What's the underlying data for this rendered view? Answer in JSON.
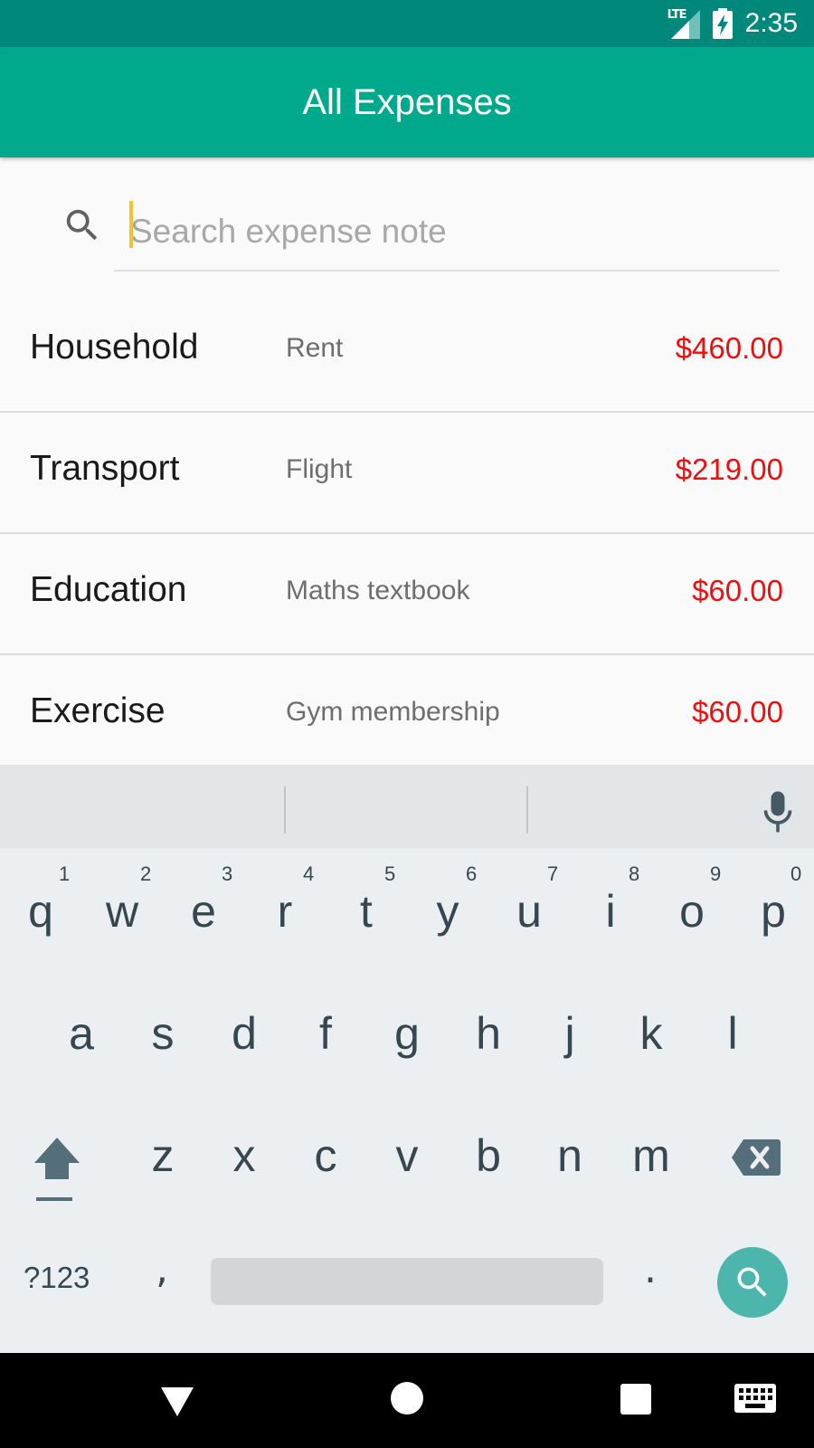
{
  "status_bar": {
    "network": "LTE",
    "time": "2:35"
  },
  "app_bar": {
    "title": "All Expenses"
  },
  "search": {
    "placeholder": "Search expense note",
    "value": ""
  },
  "expenses": [
    {
      "category": "Household",
      "note": "Rent",
      "amount": "$460.00"
    },
    {
      "category": "Transport",
      "note": "Flight",
      "amount": "$219.00"
    },
    {
      "category": "Education",
      "note": "Maths textbook",
      "amount": "$60.00"
    },
    {
      "category": "Exercise",
      "note": "Gym membership",
      "amount": "$60.00"
    }
  ],
  "keyboard": {
    "row1": [
      "q",
      "w",
      "e",
      "r",
      "t",
      "y",
      "u",
      "i",
      "o",
      "p"
    ],
    "row1_hints": [
      "1",
      "2",
      "3",
      "4",
      "5",
      "6",
      "7",
      "8",
      "9",
      "0"
    ],
    "row2": [
      "a",
      "s",
      "d",
      "f",
      "g",
      "h",
      "j",
      "k",
      "l"
    ],
    "row3": [
      "z",
      "x",
      "c",
      "v",
      "b",
      "n",
      "m"
    ],
    "symbols_label": "?123",
    "comma": ",",
    "period": "."
  },
  "colors": {
    "status_bar": "#00897b",
    "app_bar": "#00a98b",
    "amount": "#f00e0e",
    "search_action": "#4db6ac",
    "cursor": "#f4c430"
  },
  "icons": {
    "search": "search-icon",
    "mic": "microphone-icon",
    "shift": "shift-icon",
    "delete": "backspace-icon",
    "nav_back": "back-triangle-icon",
    "nav_home": "home-circle-icon",
    "nav_recents": "recents-square-icon",
    "nav_keyboard": "keyboard-icon"
  }
}
